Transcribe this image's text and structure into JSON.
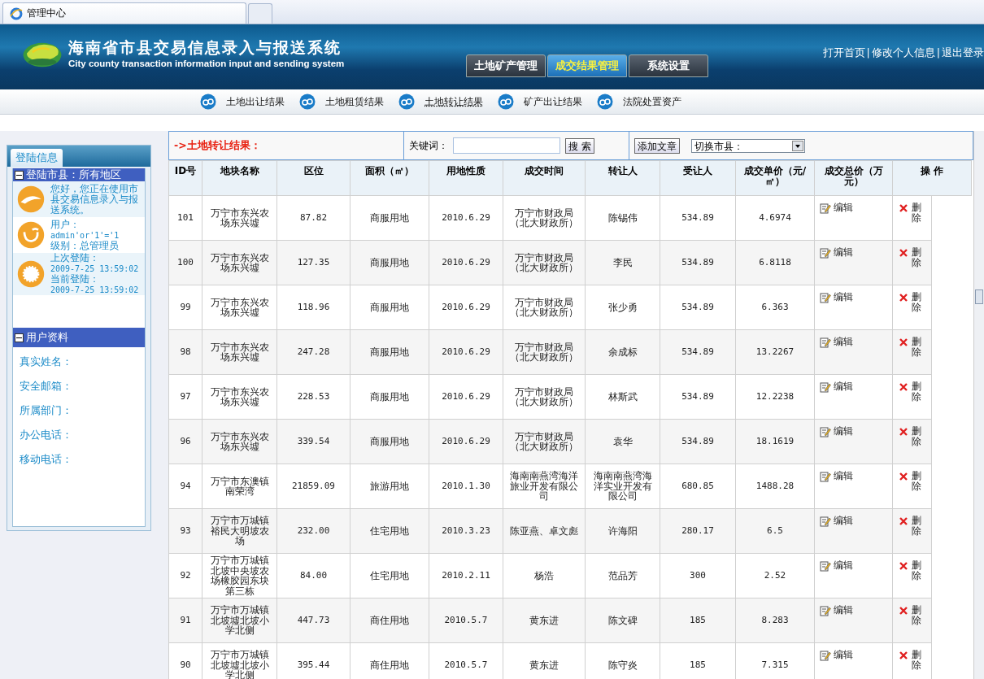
{
  "browser_tab": {
    "title": "管理中心"
  },
  "header": {
    "title": "海南省市县交易信息录入与报送系统",
    "subtitle": "City county transaction information input and sending system",
    "tabs": [
      {
        "label": "土地矿产管理",
        "selected": false
      },
      {
        "label": "成交结果管理",
        "selected": true
      },
      {
        "label": "系统设置",
        "selected": false
      }
    ],
    "links": [
      "打开首页",
      "修改个人信息",
      "退出登录"
    ],
    "link_separator": "|"
  },
  "subnav": [
    {
      "label": "土地出让结果",
      "selected": false
    },
    {
      "label": "土地租赁结果",
      "selected": false
    },
    {
      "label": "土地转让结果",
      "selected": true
    },
    {
      "label": "矿产出让结果",
      "selected": false
    },
    {
      "label": "法院处置资产",
      "selected": false
    }
  ],
  "sidebar": {
    "tab": "登陆信息",
    "login_section": {
      "title": "登陆市县：所有地区",
      "greeting": "您好，您正在使用市县交易信息录入与报送系统。",
      "user_label": "用户：",
      "user": "admin'or'1'='1",
      "level": "级别：总管理员",
      "last_login_label": "上次登陆：",
      "last_login": "2009-7-25 13:59:02",
      "current_login_label": "当前登陆：",
      "current_login": "2009-7-25 13:59:02"
    },
    "profile": {
      "title": "用户资料",
      "fields": [
        "真实姓名：",
        "安全邮箱：",
        "所属部门：",
        "办公电话：",
        "移动电话："
      ]
    }
  },
  "toolbar": {
    "heading": "->土地转让结果：",
    "keyword_label": "关键词：",
    "search_button": "搜 索",
    "add_button": "添加文章",
    "city_select": "切换市县："
  },
  "table": {
    "columns": [
      "ID号",
      "地块名称",
      "区位",
      "面积（㎡）",
      "用地性质",
      "成交时间",
      "转让人",
      "受让人",
      "成交单价（元/㎡）",
      "成交总价（万元）",
      "操 作"
    ],
    "rows": [
      {
        "id": "101",
        "location": "万宁市东兴农场东兴墟",
        "area": "87.82",
        "use": "商服用地",
        "date": "2010.6.29",
        "transferor": "万宁市财政局（北大财政所）",
        "transferee": "陈锡伟",
        "unit_price": "534.89",
        "total_price": "4.6974",
        "actions": [
          "编辑",
          "删除"
        ]
      },
      {
        "id": "100",
        "location": "万宁市东兴农场东兴墟",
        "area": "127.35",
        "use": "商服用地",
        "date": "2010.6.29",
        "transferor": "万宁市财政局（北大财政所）",
        "transferee": "李民",
        "unit_price": "534.89",
        "total_price": "6.8118",
        "actions": [
          "编辑",
          "删除"
        ]
      },
      {
        "id": "99",
        "location": "万宁市东兴农场东兴墟",
        "area": "118.96",
        "use": "商服用地",
        "date": "2010.6.29",
        "transferor": "万宁市财政局（北大财政所）",
        "transferee": "张少勇",
        "unit_price": "534.89",
        "total_price": "6.363",
        "actions": [
          "编辑",
          "删除"
        ]
      },
      {
        "id": "98",
        "location": "万宁市东兴农场东兴墟",
        "area": "247.28",
        "use": "商服用地",
        "date": "2010.6.29",
        "transferor": "万宁市财政局（北大财政所）",
        "transferee": "余成标",
        "unit_price": "534.89",
        "total_price": "13.2267",
        "actions": [
          "编辑",
          "删除"
        ]
      },
      {
        "id": "97",
        "location": "万宁市东兴农场东兴墟",
        "area": "228.53",
        "use": "商服用地",
        "date": "2010.6.29",
        "transferor": "万宁市财政局（北大财政所）",
        "transferee": "林斯武",
        "unit_price": "534.89",
        "total_price": "12.2238",
        "actions": [
          "编辑",
          "删除"
        ]
      },
      {
        "id": "96",
        "location": "万宁市东兴农场东兴墟",
        "area": "339.54",
        "use": "商服用地",
        "date": "2010.6.29",
        "transferor": "万宁市财政局（北大财政所）",
        "transferee": "袁华",
        "unit_price": "534.89",
        "total_price": "18.1619",
        "actions": [
          "编辑",
          "删除"
        ]
      },
      {
        "id": "94",
        "location": "万宁市东澳镇南荣湾",
        "area": "21859.09",
        "use": "旅游用地",
        "date": "2010.1.30",
        "transferor": "海南南燕湾海洋旅业开发有限公司",
        "transferee": "海南南燕湾海洋实业开发有限公司",
        "unit_price": "680.85",
        "total_price": "1488.28",
        "actions": [
          "编辑",
          "删除"
        ]
      },
      {
        "id": "93",
        "location": "万宁市万城镇裕民大明坡农场",
        "area": "232.00",
        "use": "住宅用地",
        "date": "2010.3.23",
        "transferor": "陈亚燕、卓文彪",
        "transferee": "许海阳",
        "unit_price": "280.17",
        "total_price": "6.5",
        "actions": [
          "编辑",
          "删除"
        ]
      },
      {
        "id": "92",
        "location": "万宁市万城镇北坡中央坡农场橡胶园东块第三栋",
        "area": "84.00",
        "use": "住宅用地",
        "date": "2010.2.11",
        "transferor": "杨浩",
        "transferee": "范品芳",
        "unit_price": "300",
        "total_price": "2.52",
        "actions": [
          "编辑",
          "删除"
        ]
      },
      {
        "id": "91",
        "location": "万宁市万城镇北坡墟北坡小学北侧",
        "area": "447.73",
        "use": "商住用地",
        "date": "2010.5.7",
        "transferor": "黄东进",
        "transferee": "陈文碑",
        "unit_price": "185",
        "total_price": "8.283",
        "actions": [
          "编辑",
          "删除"
        ]
      },
      {
        "id": "90",
        "location": "万宁市万城镇北坡墟北坡小学北侧",
        "area": "395.44",
        "use": "商住用地",
        "date": "2010.5.7",
        "transferor": "黄东进",
        "transferee": "陈守炎",
        "unit_price": "185",
        "total_price": "7.315",
        "actions": [
          "编辑",
          "删除"
        ]
      }
    ]
  }
}
